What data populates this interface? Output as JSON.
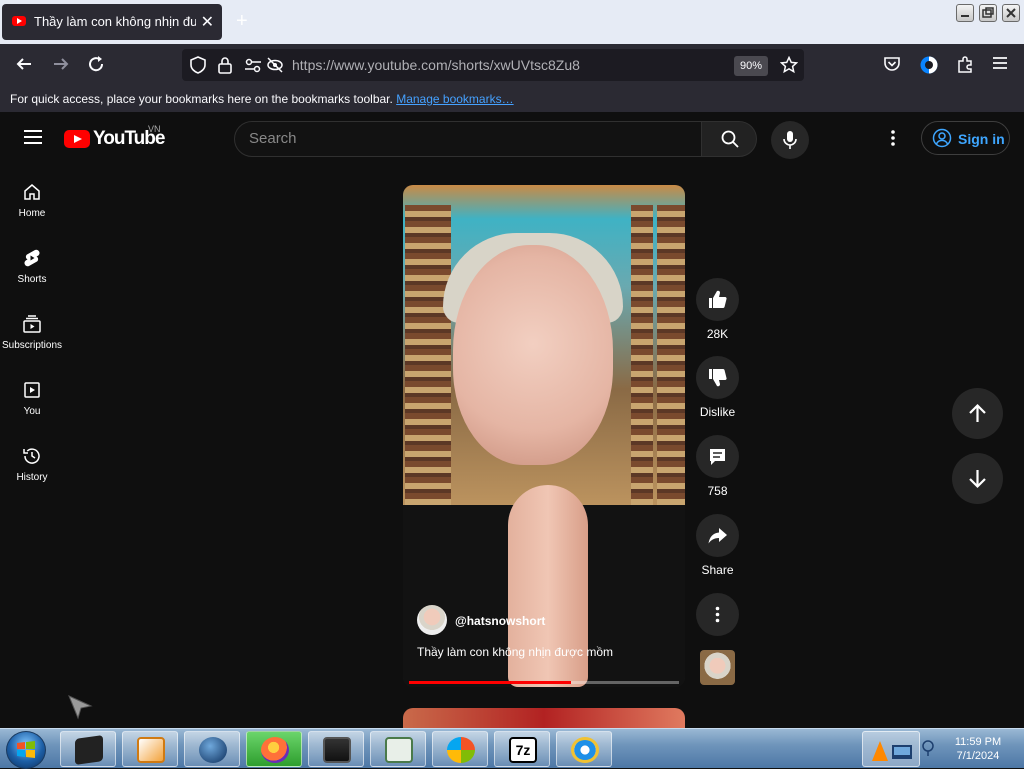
{
  "browser": {
    "tab_title": "Thầy làm con không nhịn được mồm",
    "tab_close": "✕",
    "new_tab": "+",
    "url": "https://www.youtube.com/shorts/xwUVtsc8Zu8",
    "zoom": "90%",
    "bookmarks_message": "For quick access, place your bookmarks here on the bookmarks toolbar.",
    "bookmarks_link": "Manage bookmarks…"
  },
  "youtube": {
    "logo_text": "YouTube",
    "country_code": "VN",
    "search_placeholder": "Search",
    "sign_in": "Sign in"
  },
  "sidebar": {
    "items": [
      {
        "label": "Home",
        "icon": "home-icon"
      },
      {
        "label": "Shorts",
        "icon": "shorts-icon"
      },
      {
        "label": "Subscriptions",
        "icon": "subscriptions-icon"
      },
      {
        "label": "You",
        "icon": "you-icon"
      },
      {
        "label": "History",
        "icon": "history-icon"
      }
    ]
  },
  "video": {
    "channel": "@hatsnowshort",
    "title": "Thầy làm con không nhịn được mồm",
    "progress": 0.6
  },
  "actions": {
    "likes": "28K",
    "dislike": "Dislike",
    "comments": "758",
    "share": "Share"
  },
  "taskbar": {
    "time": "11:59 PM",
    "date": "7/1/2024"
  },
  "colors": {
    "youtube_red": "#ff0000",
    "link_blue": "#3ea6ff",
    "background": "#0f0f0f"
  }
}
